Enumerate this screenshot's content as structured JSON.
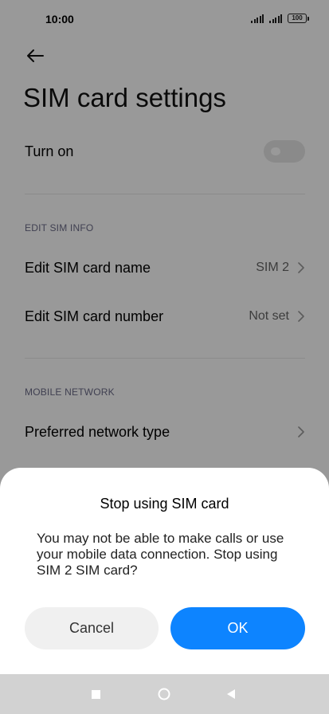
{
  "status_bar": {
    "time": "10:00",
    "battery": "100"
  },
  "header": {
    "title": "SIM card settings"
  },
  "turn_on": {
    "label": "Turn on",
    "state": "off"
  },
  "edit_sim_info": {
    "header": "EDIT SIM INFO",
    "name_label": "Edit SIM card name",
    "name_value": "SIM 2",
    "number_label": "Edit SIM card number",
    "number_value": "Not set"
  },
  "mobile_network": {
    "header": "MOBILE NETWORK",
    "preferred_label": "Preferred network type"
  },
  "dialog": {
    "title": "Stop using SIM card",
    "message": "You may not be able to make calls or use your mobile data connection. Stop using SIM 2 SIM card?",
    "cancel_label": "Cancel",
    "ok_label": "OK"
  },
  "colors": {
    "accent": "#0d84ff",
    "dim": "rgba(0,0,0,0.40)",
    "nav_bar": "#d2d2d2"
  },
  "icons": [
    "back-arrow-icon",
    "chevron-right-icon",
    "signal-icon",
    "battery-icon",
    "recent-apps-icon",
    "home-icon",
    "back-icon"
  ]
}
